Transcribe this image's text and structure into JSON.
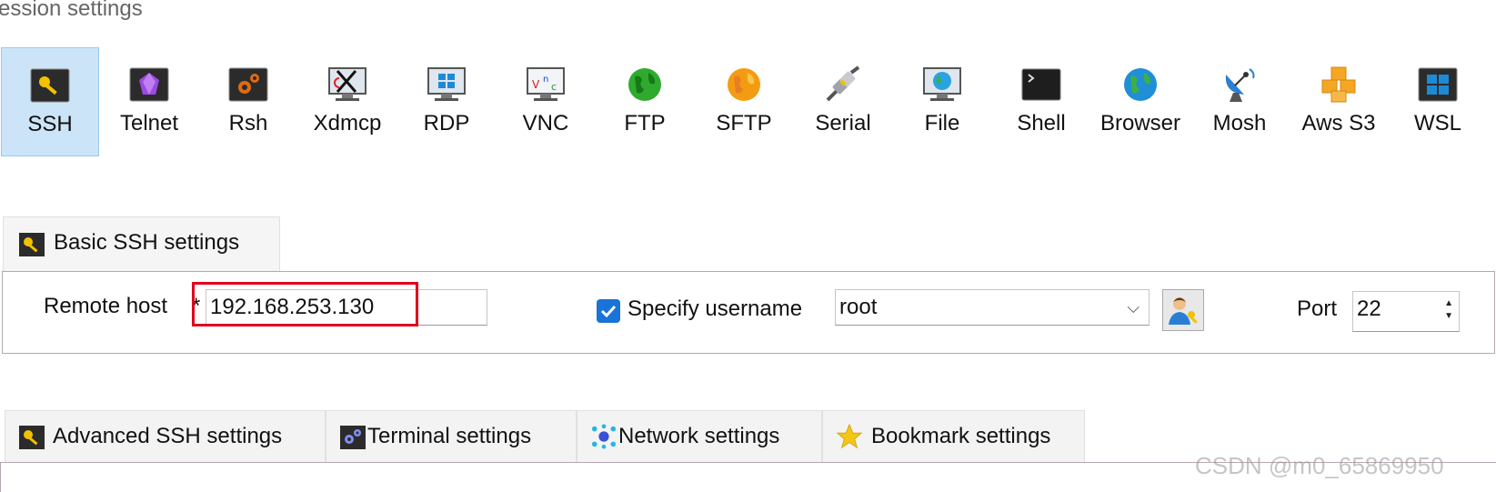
{
  "window": {
    "title": "ession settings"
  },
  "session_types": [
    {
      "label": "SSH",
      "icon": "ssh-key-icon",
      "selected": true
    },
    {
      "label": "Telnet",
      "icon": "telnet-gem-icon",
      "selected": false
    },
    {
      "label": "Rsh",
      "icon": "rsh-gears-icon",
      "selected": false
    },
    {
      "label": "Xdmcp",
      "icon": "xdmcp-x-icon",
      "selected": false
    },
    {
      "label": "RDP",
      "icon": "rdp-windows-monitor-icon",
      "selected": false
    },
    {
      "label": "VNC",
      "icon": "vnc-monitor-icon",
      "selected": false
    },
    {
      "label": "FTP",
      "icon": "ftp-globe-green-icon",
      "selected": false
    },
    {
      "label": "SFTP",
      "icon": "sftp-globe-orange-icon",
      "selected": false
    },
    {
      "label": "Serial",
      "icon": "serial-plug-icon",
      "selected": false
    },
    {
      "label": "File",
      "icon": "file-monitor-globe-icon",
      "selected": false
    },
    {
      "label": "Shell",
      "icon": "shell-terminal-icon",
      "selected": false
    },
    {
      "label": "Browser",
      "icon": "browser-globe-icon",
      "selected": false
    },
    {
      "label": "Mosh",
      "icon": "mosh-satellite-icon",
      "selected": false
    },
    {
      "label": "Aws S3",
      "icon": "aws-s3-cubes-icon",
      "selected": false
    },
    {
      "label": "WSL",
      "icon": "wsl-windows-icon",
      "selected": false
    }
  ],
  "basic": {
    "tab_label": "Basic SSH settings",
    "remote_host_label": "Remote host",
    "required_mark": "*",
    "remote_host_value": "192.168.253.130",
    "specify_username_label": "Specify username",
    "specify_username_checked": true,
    "username_value": "root",
    "dropdown_arrow": "⌵",
    "port_label": "Port",
    "port_value": "22"
  },
  "settings_tabs": [
    {
      "label": "Advanced SSH settings",
      "icon": "key-icon"
    },
    {
      "label": "Terminal settings",
      "icon": "terminal-gears-icon"
    },
    {
      "label": "Network settings",
      "icon": "network-nodes-icon"
    },
    {
      "label": "Bookmark settings",
      "icon": "star-icon"
    }
  ],
  "watermark": "CSDN @m0_65869950",
  "colors": {
    "selected_bg": "#cce4f7",
    "checkbox": "#1a73d6",
    "highlight_box": "#e0001a"
  }
}
